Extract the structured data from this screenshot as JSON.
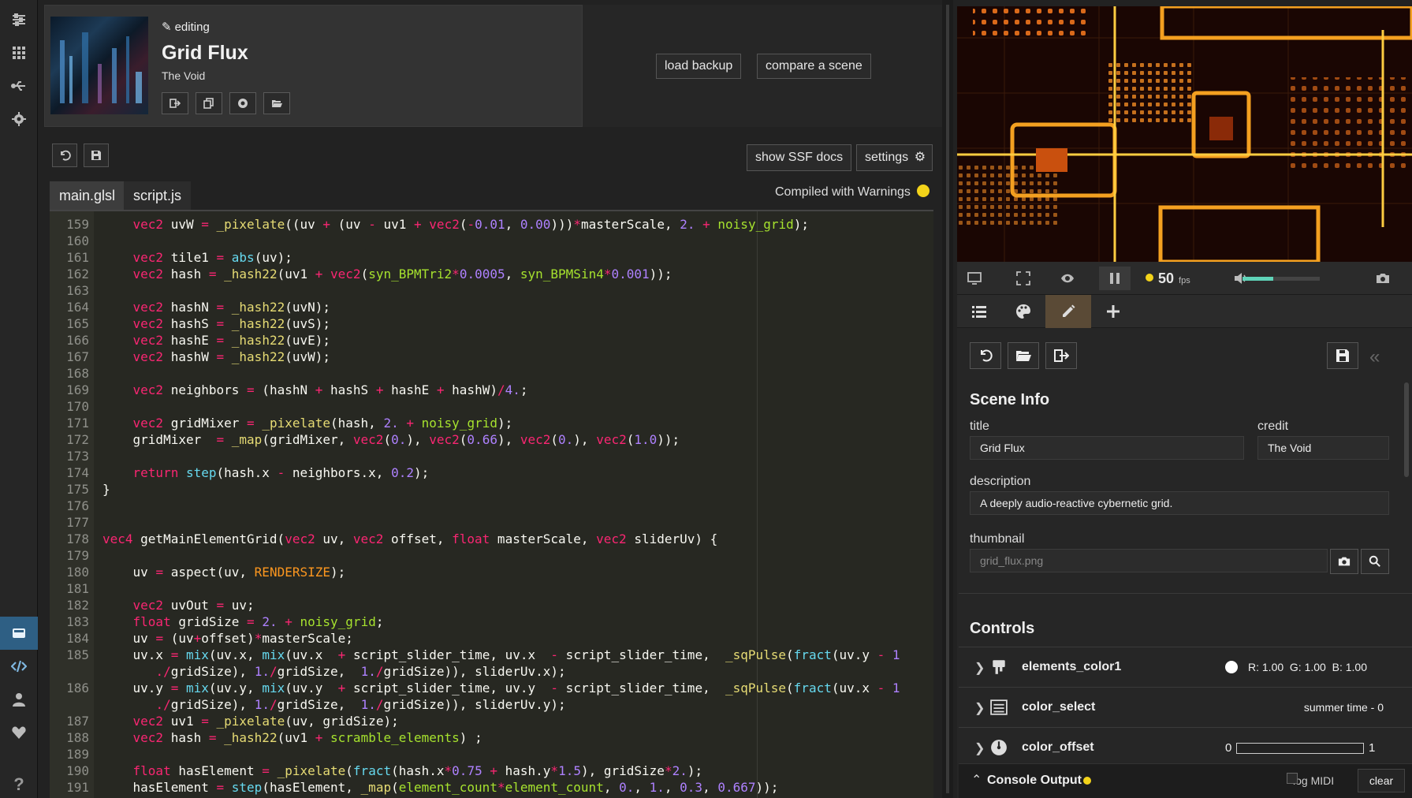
{
  "header": {
    "editing_label": "editing",
    "scene_title": "Grid Flux",
    "scene_credit": "The Void",
    "load_backup": "load backup",
    "compare_scene": "compare a scene"
  },
  "editor": {
    "show_docs": "show SSF docs",
    "settings": "settings",
    "tabs": [
      "main.glsl",
      "script.js"
    ],
    "active_tab": "main.glsl",
    "status": "Compiled with Warnings",
    "status_color": "#f3d31a"
  },
  "code_lines": [
    {
      "n": "159",
      "html": "    <span class=\"ty\">vec2</span> uvW <span class=\"kw\">=</span> <span class=\"fn\">_pixelate</span>((uv <span class=\"kw\">+</span> (uv <span class=\"kw\">-</span> uv1 <span class=\"kw\">+</span> <span class=\"ty\">vec2</span>(<span class=\"kw\">-</span><span class=\"num\">0.01</span>, <span class=\"num\">0.00</span>)))<span class=\"kw\">*</span>masterScale, <span class=\"num\">2.</span> <span class=\"kw\">+</span> <span class=\"var\">noisy_grid</span>);"
    },
    {
      "n": "160",
      "html": ""
    },
    {
      "n": "161",
      "html": "    <span class=\"ty\">vec2</span> tile1 <span class=\"kw\">=</span> <span class=\"bi\">abs</span>(uv);"
    },
    {
      "n": "162",
      "html": "    <span class=\"ty\">vec2</span> hash <span class=\"kw\">=</span> <span class=\"fn\">_hash22</span>(uv1 <span class=\"kw\">+</span> <span class=\"ty\">vec2</span>(<span class=\"var\">syn_BPMTri2</span><span class=\"kw\">*</span><span class=\"num\">0.0005</span>, <span class=\"var\">syn_BPMSin4</span><span class=\"kw\">*</span><span class=\"num\">0.001</span>));"
    },
    {
      "n": "163",
      "html": ""
    },
    {
      "n": "164",
      "html": "    <span class=\"ty\">vec2</span> hashN <span class=\"kw\">=</span> <span class=\"fn\">_hash22</span>(uvN);"
    },
    {
      "n": "165",
      "html": "    <span class=\"ty\">vec2</span> hashS <span class=\"kw\">=</span> <span class=\"fn\">_hash22</span>(uvS);"
    },
    {
      "n": "166",
      "html": "    <span class=\"ty\">vec2</span> hashE <span class=\"kw\">=</span> <span class=\"fn\">_hash22</span>(uvE);"
    },
    {
      "n": "167",
      "html": "    <span class=\"ty\">vec2</span> hashW <span class=\"kw\">=</span> <span class=\"fn\">_hash22</span>(uvW);"
    },
    {
      "n": "168",
      "html": ""
    },
    {
      "n": "169",
      "html": "    <span class=\"ty\">vec2</span> neighbors <span class=\"kw\">=</span> (hashN <span class=\"kw\">+</span> hashS <span class=\"kw\">+</span> hashE <span class=\"kw\">+</span> hashW)<span class=\"kw\">/</span><span class=\"num\">4.</span>;"
    },
    {
      "n": "170",
      "html": ""
    },
    {
      "n": "171",
      "html": "    <span class=\"ty\">vec2</span> gridMixer <span class=\"kw\">=</span> <span class=\"fn\">_pixelate</span>(hash, <span class=\"num\">2.</span> <span class=\"kw\">+</span> <span class=\"var\">noisy_grid</span>);"
    },
    {
      "n": "172",
      "html": "    gridMixer  <span class=\"kw\">=</span> <span class=\"fn\">_map</span>(gridMixer, <span class=\"ty\">vec2</span>(<span class=\"num\">0.</span>), <span class=\"ty\">vec2</span>(<span class=\"num\">0.66</span>), <span class=\"ty\">vec2</span>(<span class=\"num\">0.</span>), <span class=\"ty\">vec2</span>(<span class=\"num\">1.0</span>));"
    },
    {
      "n": "173",
      "html": ""
    },
    {
      "n": "174",
      "html": "    <span class=\"kw\">return</span> <span class=\"bi\">step</span>(hash.x <span class=\"kw\">-</span> neighbors.x, <span class=\"num\">0.2</span>);"
    },
    {
      "n": "175",
      "html": "}"
    },
    {
      "n": "176",
      "html": ""
    },
    {
      "n": "177",
      "html": ""
    },
    {
      "n": "178",
      "html": "<span class=\"ty\">vec4</span> getMainElementGrid(<span class=\"ty\">vec2</span> uv, <span class=\"ty\">vec2</span> offset, <span class=\"ty\">float</span> masterScale, <span class=\"ty\">vec2</span> sliderUv) {"
    },
    {
      "n": "179",
      "html": ""
    },
    {
      "n": "180",
      "html": "    uv <span class=\"kw\">=</span> aspect(uv, <span class=\"cst\">RENDERSIZE</span>);"
    },
    {
      "n": "181",
      "html": ""
    },
    {
      "n": "182",
      "html": "    <span class=\"ty\">vec2</span> uvOut <span class=\"kw\">=</span> uv;"
    },
    {
      "n": "183",
      "html": "    <span class=\"ty\">float</span> gridSize <span class=\"kw\">=</span> <span class=\"num\">2.</span> <span class=\"kw\">+</span> <span class=\"var\">noisy_grid</span>;"
    },
    {
      "n": "184",
      "html": "    uv <span class=\"kw\">=</span> (uv<span class=\"kw\">+</span>offset)<span class=\"kw\">*</span>masterScale;"
    },
    {
      "n": "185",
      "html": "    uv.x <span class=\"kw\">=</span> <span class=\"bi\">mix</span>(uv.x, <span class=\"bi\">mix</span>(uv.x  <span class=\"kw\">+</span> script_slider_time, uv.x  <span class=\"kw\">-</span> script_slider_time,  <span class=\"fn\">_sqPulse</span>(<span class=\"bi\">fract</span>(uv.y <span class=\"kw\">-</span> <span class=\"num\">1</span>"
    },
    {
      "n": "",
      "html": "       <span class=\"kw\">.</span><span class=\"kw\">/</span>gridSize), <span class=\"num\">1.</span><span class=\"kw\">/</span>gridSize,  <span class=\"num\">1.</span><span class=\"kw\">/</span>gridSize)), sliderUv.x);"
    },
    {
      "n": "186",
      "html": "    uv.y <span class=\"kw\">=</span> <span class=\"bi\">mix</span>(uv.y, <span class=\"bi\">mix</span>(uv.y  <span class=\"kw\">+</span> script_slider_time, uv.y  <span class=\"kw\">-</span> script_slider_time,  <span class=\"fn\">_sqPulse</span>(<span class=\"bi\">fract</span>(uv.x <span class=\"kw\">-</span> <span class=\"num\">1</span>"
    },
    {
      "n": "",
      "html": "       <span class=\"kw\">.</span><span class=\"kw\">/</span>gridSize), <span class=\"num\">1.</span><span class=\"kw\">/</span>gridSize,  <span class=\"num\">1.</span><span class=\"kw\">/</span>gridSize)), sliderUv.y);"
    },
    {
      "n": "187",
      "html": "    <span class=\"ty\">vec2</span> uv1 <span class=\"kw\">=</span> <span class=\"fn\">_pixelate</span>(uv, gridSize);"
    },
    {
      "n": "188",
      "html": "    <span class=\"ty\">vec2</span> hash <span class=\"kw\">=</span> <span class=\"fn\">_hash22</span>(uv1 <span class=\"kw\">+</span> <span class=\"var\">scramble_elements</span>) ;"
    },
    {
      "n": "189",
      "html": ""
    },
    {
      "n": "190",
      "html": "    <span class=\"ty\">float</span> hasElement <span class=\"kw\">=</span> <span class=\"fn\">_pixelate</span>(<span class=\"bi\">fract</span>(hash.x<span class=\"kw\">*</span><span class=\"num\">0.75</span> <span class=\"kw\">+</span> hash.y<span class=\"kw\">*</span><span class=\"num\">1.5</span>), gridSize<span class=\"kw\">*</span><span class=\"num\">2.</span>);"
    },
    {
      "n": "191",
      "html": "    hasElement <span class=\"kw\">=</span> <span class=\"bi\">step</span>(hasElement, <span class=\"fn\">_map</span>(<span class=\"var\">element_count</span><span class=\"kw\">*</span><span class=\"var\">element_count</span>, <span class=\"num\">0.</span>, <span class=\"num\">1.</span>, <span class=\"num\">0.3</span>, <span class=\"num\">0.667</span>));"
    }
  ],
  "player": {
    "fps_value": "50",
    "fps_unit": "fps",
    "fps_dot_color": "#f3d31a",
    "volume_level": 0.4
  },
  "scene_info": {
    "heading": "Scene Info",
    "title_label": "title",
    "title_value": "Grid Flux",
    "credit_label": "credit",
    "credit_value": "The Void",
    "description_label": "description",
    "description_value": "A deeply audio-reactive cybernetic grid.",
    "thumbnail_label": "thumbnail",
    "thumbnail_placeholder": "grid_flux.png"
  },
  "controls": {
    "heading": "Controls",
    "items": [
      {
        "name": "elements_color1",
        "icon": "palette-bucket-icon",
        "value": "R: 1.00  G: 1.00  B: 1.00",
        "swatch": "#ffffff"
      },
      {
        "name": "color_select",
        "icon": "list-icon",
        "value": "summer time - 0"
      },
      {
        "name": "color_offset",
        "icon": "dial-icon",
        "min": "0",
        "max": "1"
      }
    ]
  },
  "console": {
    "title": "Console Output",
    "dot_color": "#f3d31a",
    "log_midi": "log MIDI",
    "clear": "clear"
  }
}
